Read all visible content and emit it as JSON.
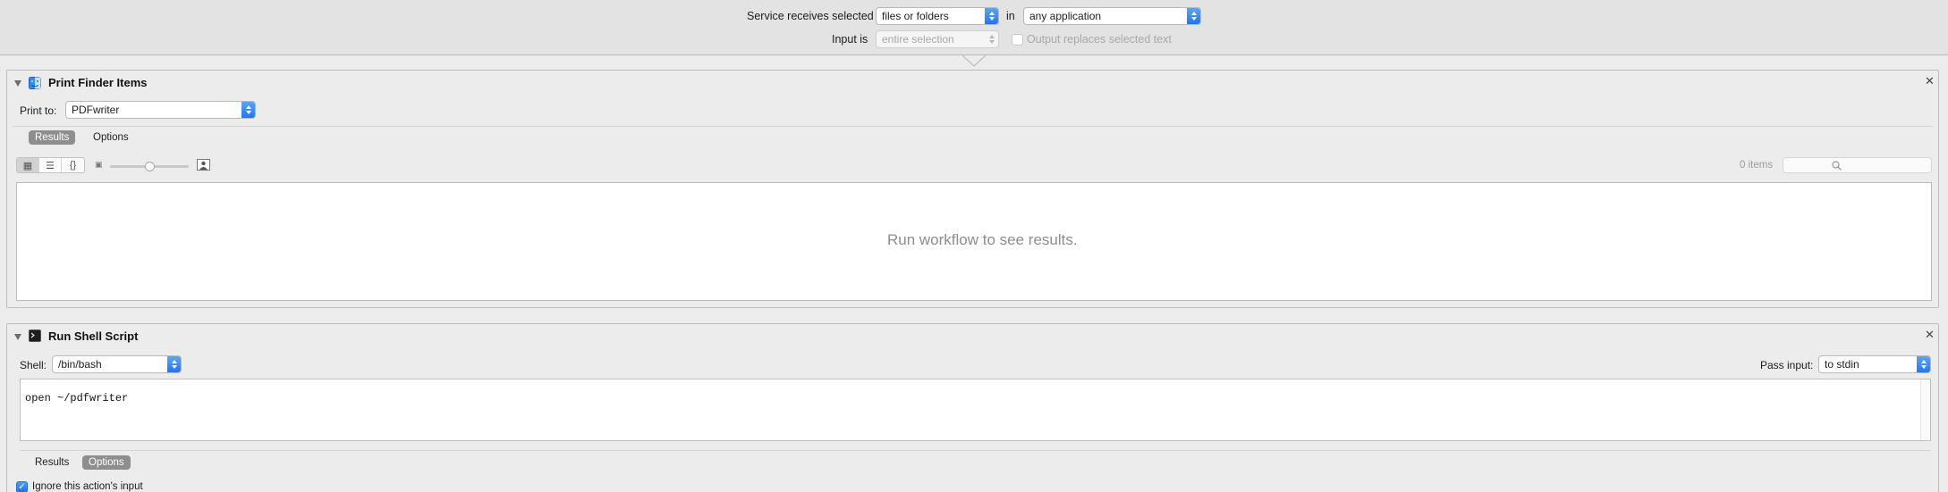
{
  "service_bar": {
    "receives_label": "Service receives selected",
    "receives_value": "files or folders",
    "in_label": "in",
    "application_value": "any application",
    "input_is_label": "Input is",
    "input_is_value": "entire selection",
    "output_replaces_label": "Output replaces selected text",
    "output_replaces_checked": false
  },
  "actions": [
    {
      "title": "Print Finder Items",
      "icon": "finder-icon",
      "print_to_label": "Print to:",
      "print_to_value": "PDFwriter",
      "tabs": [
        "Results",
        "Options"
      ],
      "selected_tab": "Results",
      "item_count": "0 items",
      "empty_message": "Run workflow to see results.",
      "zoom_level": 0.5
    },
    {
      "title": "Run Shell Script",
      "icon": "terminal-icon",
      "shell_label": "Shell:",
      "shell_value": "/bin/bash",
      "pass_input_label": "Pass input:",
      "pass_input_value": "to stdin",
      "script": "open ~/pdfwriter",
      "tabs": [
        "Results",
        "Options"
      ],
      "selected_tab": "Options",
      "ignore_input_label": "Ignore this action's input",
      "ignore_input_checked": true
    }
  ],
  "colors": {
    "accent": "#1f74f0",
    "background": "#ececec",
    "segment_selected": "#8e8e8e"
  }
}
